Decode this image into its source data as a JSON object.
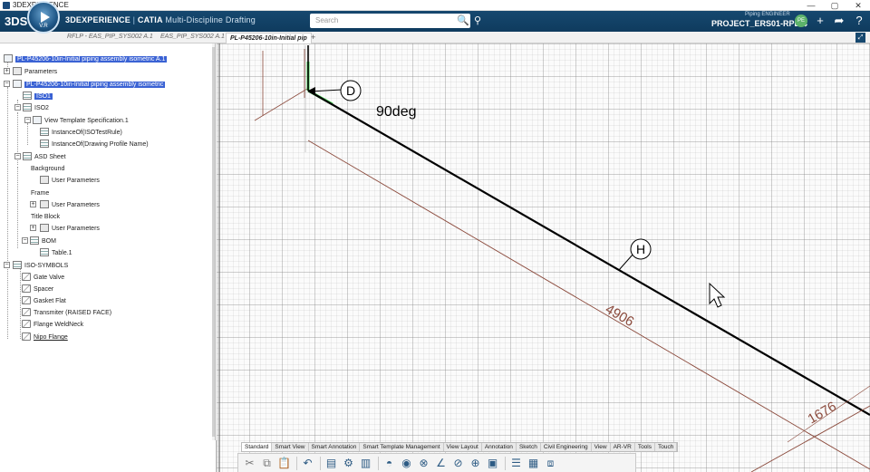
{
  "window": {
    "title": "3DEXPERIENCE",
    "min": "—",
    "max": "▢",
    "close": "✕"
  },
  "header": {
    "ds_logo": "3DS",
    "compass_version": "V.R",
    "brand_bold": "3DEXPERIENCE",
    "brand_sep": " | ",
    "brand_app": "CATIA",
    "brand_sub": " Multi-Discipline Drafting",
    "search_placeholder": "Search",
    "search_icon": "magnifier-icon",
    "role": "Piping ENGINEER",
    "project": "PROJECT_ERS01-RPE ⌄",
    "avatar_initials": "PE"
  },
  "tabs": [
    {
      "label": "RFLP - EAS_PIP_SYS002 A.1"
    },
    {
      "label": "EAS_PIP_SYS002 A.1"
    },
    {
      "label": "PL-P45206-10in-Initial pip"
    }
  ],
  "tree": {
    "root": "PL-P45206-10in-Initial piping assembly isometric A.1",
    "parameters": "Parameters",
    "assembly": "PL-P45206-10in-Initial piping assembly isometric",
    "iso1": "ISO1",
    "iso2": "ISO2",
    "view_template": "View Template Specification.1",
    "iso_test_rule": "InstanceOf(ISOTestRule)",
    "drawing_profile": "InstanceOf(Drawing Profile Name)",
    "asd_sheet": "ASD Sheet",
    "background": "Background",
    "user_params_1": "User Parameters",
    "frame": "Frame",
    "user_params_2": "User Parameters",
    "title_block": "Title Block",
    "user_params_3": "User Parameters",
    "bom": "BOM",
    "table1": "Table.1",
    "iso_symbols": "ISO-SYMBOLS",
    "gate_valve": "Gate Valve",
    "spacer": "Spacer",
    "gasket_flat": "Gasket Flat",
    "transmitter": "Transmiter (RAISED FACE)",
    "flange_weldneck": "Flange WeldNeck",
    "nipo_flange": "Nipo Flange"
  },
  "drawing": {
    "label_d": "D",
    "label_angle": "90deg",
    "label_h": "H",
    "dim_4906": "4906",
    "dim_1676": "1676"
  },
  "section_tabs": [
    "Standard",
    "Smart View",
    "Smart Annotation",
    "Smart Template Management",
    "View Layout",
    "Annotation",
    "Sketch",
    "Civil Engineering",
    "View",
    "AR-VR",
    "Tools",
    "Touch"
  ],
  "toolbar_icons": [
    "cut-icon",
    "copy-icon",
    "paste-icon",
    "undo-icon",
    "table-icon",
    "settings-icon",
    "view-icon",
    "section-icon",
    "circle-icon",
    "measure-icon",
    "angle-icon",
    "target-icon",
    "dimension-icon",
    "frame-icon",
    "align-icon",
    "grid-icon",
    "window-icon"
  ],
  "colors": {
    "header": "#16486f",
    "selection": "#3a62d4",
    "pipe": "#000000",
    "dim": "#8b4a3c",
    "leader": "#4cd95a"
  }
}
